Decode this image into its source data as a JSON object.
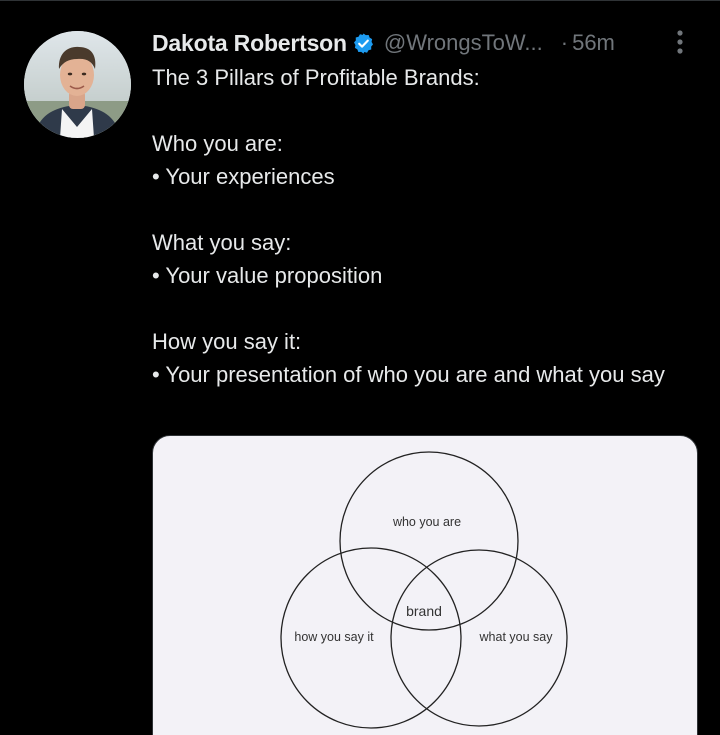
{
  "author": {
    "display_name": "Dakota Robertson",
    "handle": "@WrongsToW...",
    "separator": "·",
    "time": "56m",
    "verified": true,
    "verified_color": "#1d9bf0"
  },
  "tweet": {
    "lines": [
      "The 3 Pillars of Profitable Brands:",
      "",
      "Who you are:",
      "• Your experiences",
      "",
      "What you say:",
      "• Your value proposition",
      "",
      "How you say it:",
      "• Your presentation of who you are and what you say"
    ]
  },
  "media": {
    "labels": {
      "top": "who you are",
      "left": "how you say it",
      "right": "what you say",
      "center": "brand"
    }
  },
  "icons": {
    "more": "more-vertical-icon",
    "verified": "verified-badge-icon"
  },
  "colors": {
    "background": "#000000",
    "text": "#e7e9ea",
    "muted": "#71767b",
    "media_bg": "#f3f2f7"
  }
}
